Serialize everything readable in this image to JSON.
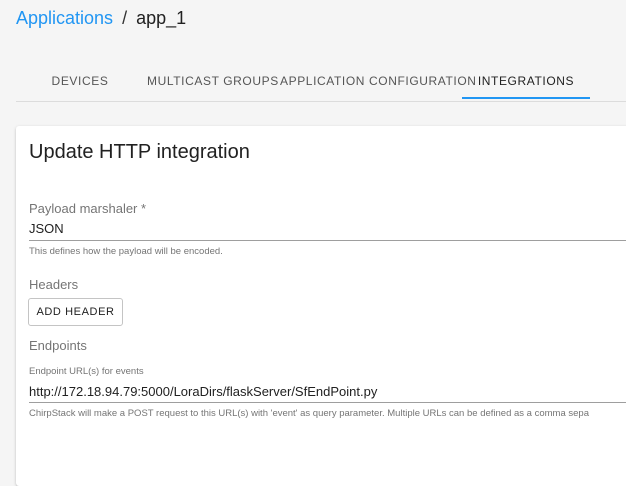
{
  "breadcrumb": {
    "parent": "Applications",
    "separator": "/",
    "current": "app_1"
  },
  "tabs": [
    {
      "label": "DEVICES",
      "active": false
    },
    {
      "label": "MULTICAST GROUPS",
      "active": false
    },
    {
      "label": "APPLICATION CONFIGURATION",
      "active": false
    },
    {
      "label": "INTEGRATIONS",
      "active": true
    }
  ],
  "form": {
    "title": "Update HTTP integration",
    "payload_marshaler": {
      "label": "Payload marshaler *",
      "value": "JSON",
      "helper": "This defines how the payload will be encoded."
    },
    "headers": {
      "label": "Headers",
      "add_button": "ADD HEADER"
    },
    "endpoints": {
      "label": "Endpoints",
      "field_label": "Endpoint URL(s) for events",
      "value": "http://172.18.94.79:5000/LoraDirs/flaskServer/SfEndPoint.py",
      "helper": "ChirpStack will make a POST request to this URL(s) with 'event' as query parameter. Multiple URLs can be defined as a comma sepa"
    }
  },
  "colors": {
    "accent": "#2196f3",
    "background": "#f5f5f5",
    "card": "#ffffff"
  }
}
